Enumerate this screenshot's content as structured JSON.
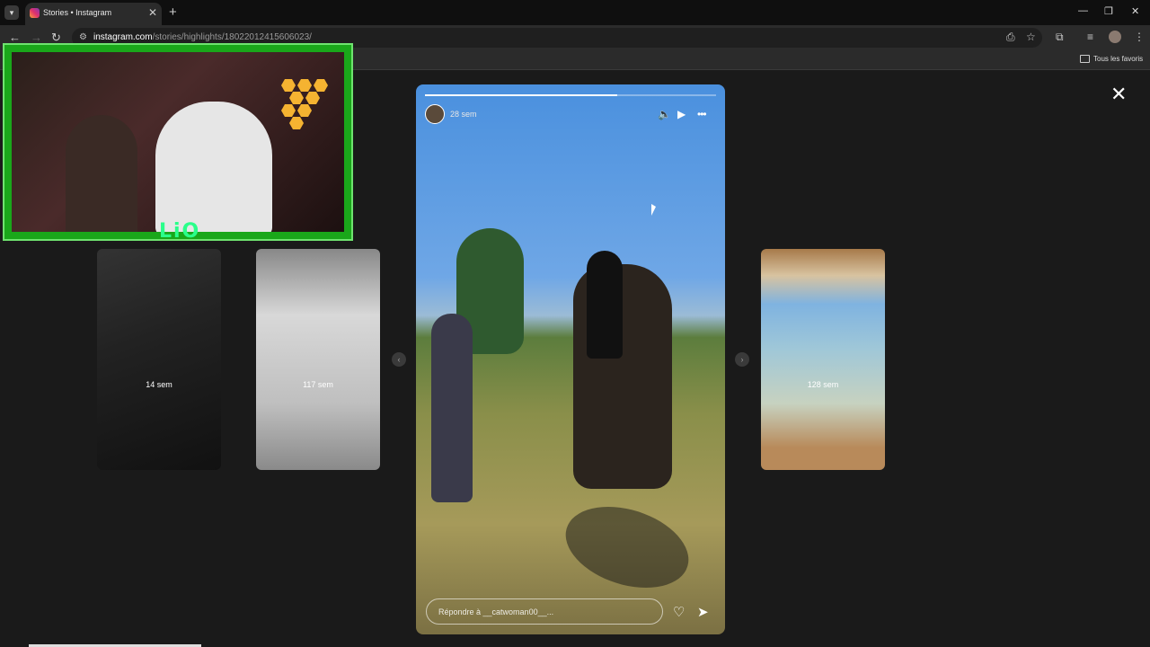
{
  "browser": {
    "tab_title": "Stories • Instagram",
    "tab_close": "✕",
    "new_tab": "+",
    "url_host": "instagram.com",
    "url_path": "/stories/highlights/18022012415606023/",
    "bookmarks_label": "Tous les favoris",
    "controls": {
      "minimize": "—",
      "restore": "❐",
      "close": "✕"
    }
  },
  "stream_overlay": {
    "logo_text": "LiO"
  },
  "thumbnails": [
    {
      "age": "14 sem"
    },
    {
      "age": "117 sem"
    },
    {
      "age": "128 sem"
    }
  ],
  "story": {
    "age": "28 sem",
    "progress": 0.66,
    "reply_placeholder": "Répondre à __catwoman00__..."
  },
  "icons": {
    "close": "✕",
    "prev": "‹",
    "next": "›",
    "mute": "🔈",
    "play": "▶",
    "more": "•••",
    "like": "♡",
    "share": "➤"
  },
  "colors": {
    "overlay_green": "#1aa71a",
    "page_bg": "#1a1a1a"
  }
}
